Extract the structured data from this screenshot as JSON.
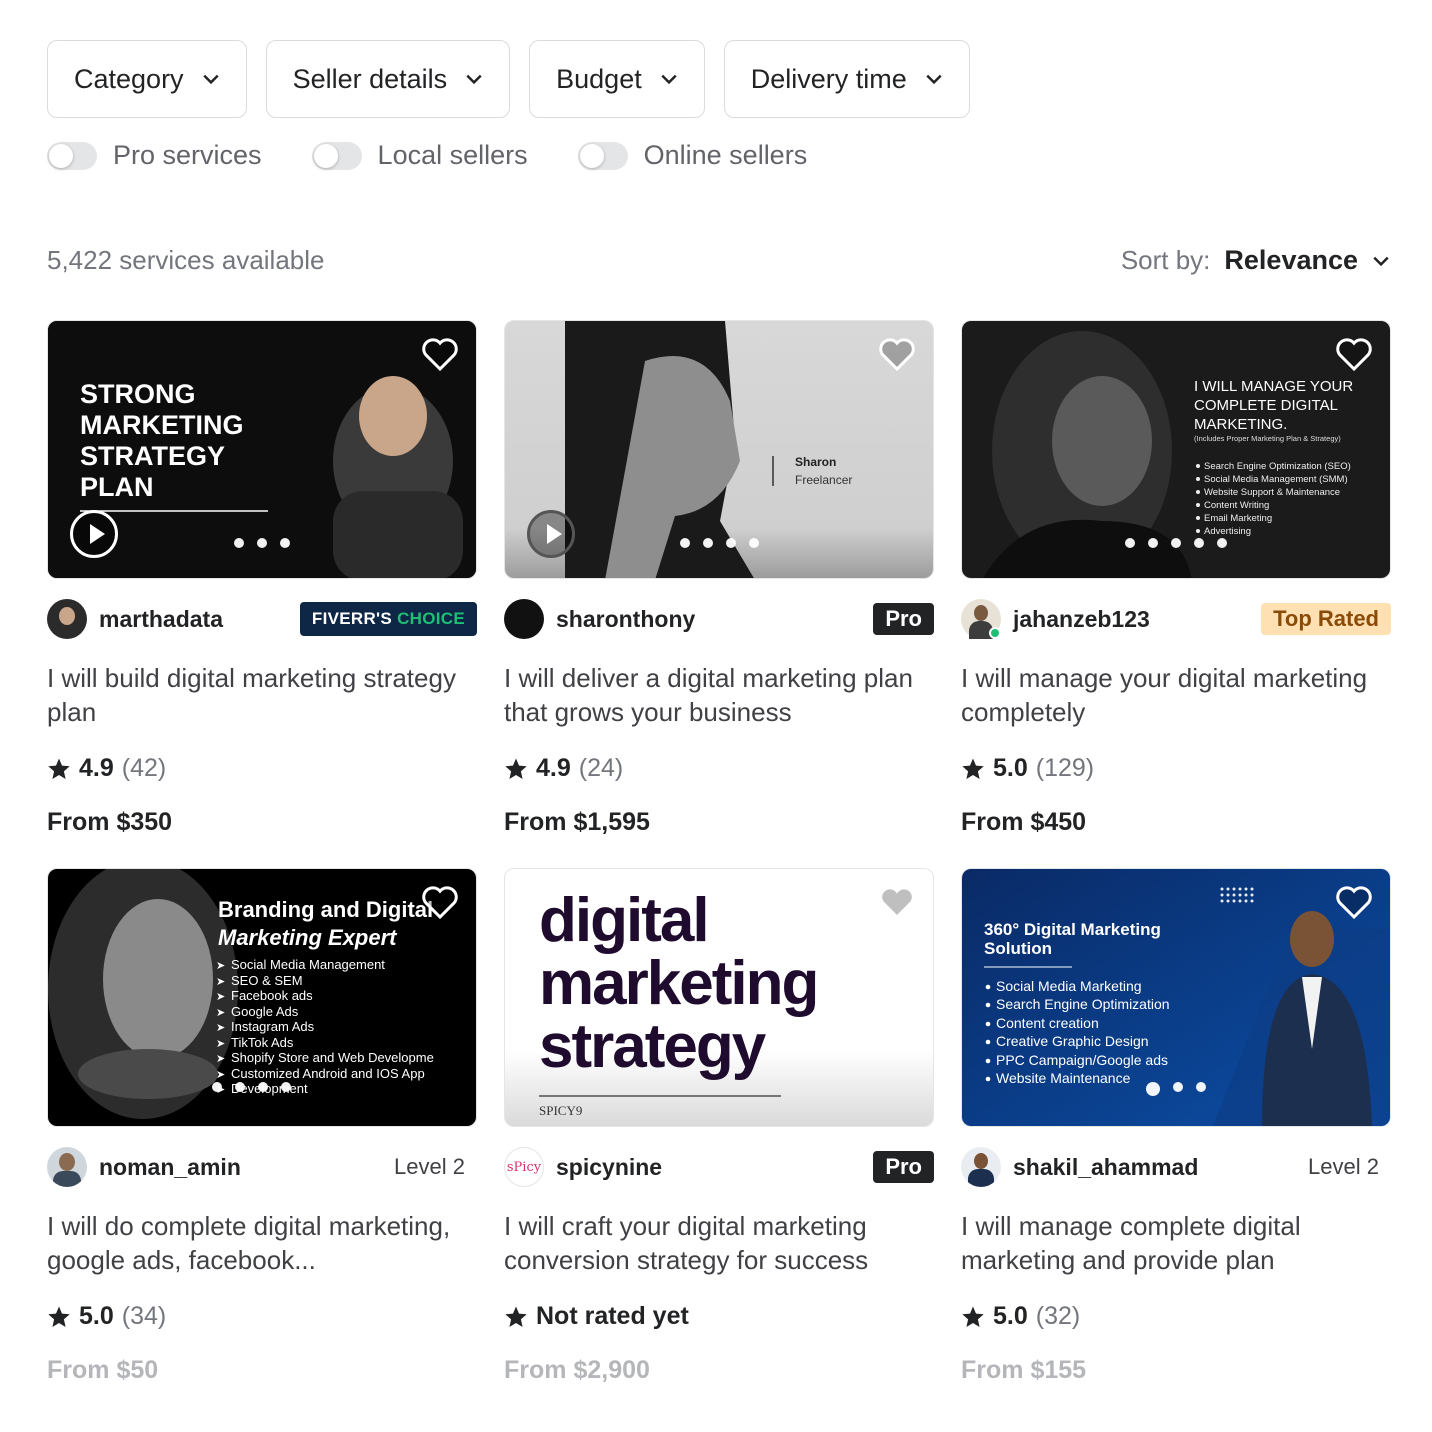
{
  "filters": [
    "Category",
    "Seller details",
    "Budget",
    "Delivery time"
  ],
  "toggles": [
    "Pro services",
    "Local sellers",
    "Online sellers"
  ],
  "results": {
    "count_text": "5,422 services available"
  },
  "sort": {
    "label": "Sort by:",
    "value": "Relevance"
  },
  "gigs": [
    {
      "seller": "marthadata",
      "badge": "FIVERR'S CHOICE",
      "badge_a": "FIVERR'S ",
      "badge_b": "CHOICE",
      "badge_type": "choice",
      "title": "I will build digital marketing strategy plan",
      "score": "4.9",
      "reviews": "(42)",
      "price": "From $350",
      "thumb_lines": [
        "STRONG",
        "MARKETING",
        "STRATEGY",
        "PLAN"
      ]
    },
    {
      "seller": "sharonthony",
      "badge": "Pro",
      "badge_type": "pro",
      "title": "I will deliver a digital marketing plan that grows your business",
      "score": "4.9",
      "reviews": "(24)",
      "price": "From $1,595",
      "thumb_name": "Sharon",
      "thumb_role": "Freelancer"
    },
    {
      "seller": "jahanzeb123",
      "badge": "Top Rated",
      "badge_type": "top",
      "title": "I will manage your digital marketing completely",
      "score": "5.0",
      "reviews": "(129)",
      "price": "From $450",
      "thumb_lines": [
        "I WILL MANAGE YOUR",
        "COMPLETE DIGITAL",
        "MARKETING."
      ],
      "thumb_sub": "(Includes Proper Marketing Plan & Strategy)",
      "thumb_items": [
        "Search Engine Optimization (SEO)",
        "Social Media Management (SMM)",
        "Website Support & Maintenance",
        "Content Writing",
        "Email Marketing",
        "Advertising"
      ]
    },
    {
      "seller": "noman_amin",
      "badge": "Level 2",
      "badge_type": "level",
      "title": "I will do complete digital marketing, google ads, facebook...",
      "score": "5.0",
      "reviews": "(34)",
      "price": "From $50",
      "thumb_lines": [
        "Branding and Digital",
        "Marketing Expert"
      ],
      "thumb_items": [
        "Social Media Management",
        "SEO & SEM",
        "Facebook ads",
        "Google Ads",
        "Instagram Ads",
        "TikTok Ads",
        "Shopify Store and Web Developme",
        "Customized Android and IOS App",
        "Development"
      ]
    },
    {
      "seller": "spicynine",
      "badge": "Pro",
      "badge_type": "pro",
      "title": "I will craft your digital marketing conversion strategy for success",
      "score": "Not rated yet",
      "reviews": "",
      "price": "From $2,900",
      "thumb_lines": [
        "digital",
        "marketing",
        "strategy"
      ],
      "thumb_footer": "SPICY9"
    },
    {
      "seller": "shakil_ahammad",
      "badge": "Level 2",
      "badge_type": "level",
      "title": "I will manage complete digital marketing and provide plan",
      "score": "5.0",
      "reviews": "(32)",
      "price": "From $155",
      "thumb_lines": [
        "360° Digital Marketing",
        "Solution"
      ],
      "thumb_items": [
        "Social Media Marketing",
        "Search Engine Optimization",
        "Content creation",
        "Creative Graphic Design",
        "PPC Campaign/Google ads",
        "Website Maintenance"
      ]
    }
  ],
  "colors": {
    "accent_green": "#1dbf73",
    "choice_bg": "#0f2747",
    "top_rated_bg": "#ffe0b3",
    "text": "#222325",
    "muted": "#74767e"
  }
}
